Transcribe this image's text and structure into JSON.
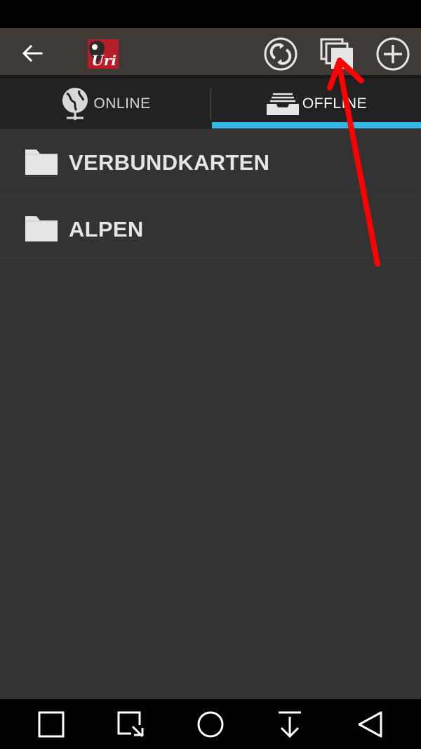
{
  "action_bar": {
    "back_icon": "arrow-back-icon",
    "logo_text": "Uri",
    "actions": [
      {
        "name": "sync-icon"
      },
      {
        "name": "layers-icon"
      },
      {
        "name": "add-circle-icon"
      }
    ]
  },
  "tabs": [
    {
      "label": "ONLINE",
      "icon": "globe-icon",
      "selected": false
    },
    {
      "label": "OFFLINE",
      "icon": "tray-icon",
      "selected": true
    }
  ],
  "folders": [
    {
      "label": "VERBUNDKARTEN",
      "icon": "folder-icon"
    },
    {
      "label": "ALPEN",
      "icon": "folder-icon"
    }
  ],
  "navigation_bar": {
    "buttons": [
      "square-icon",
      "screenshot-icon",
      "home-circle-icon",
      "download-icon",
      "back-triangle-icon"
    ]
  },
  "colors": {
    "accent": "#33b5e5",
    "annotation": "#ff0000",
    "background": "#333333"
  }
}
